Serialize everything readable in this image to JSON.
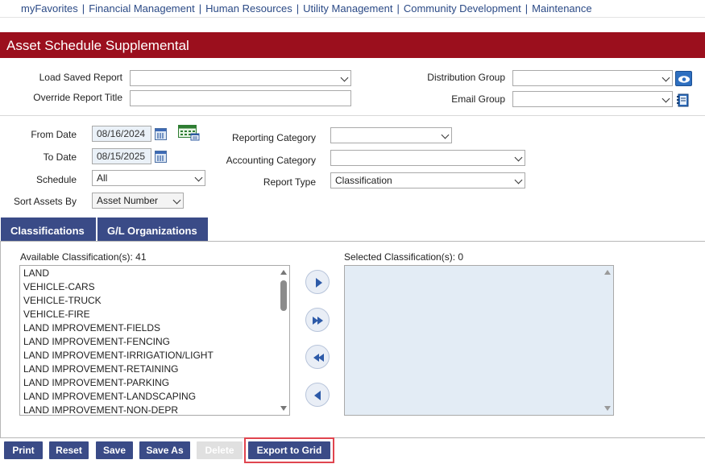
{
  "nav": {
    "items": [
      "myFavorites",
      "Financial Management",
      "Human Resources",
      "Utility Management",
      "Community Development",
      "Maintenance"
    ]
  },
  "page": {
    "title": "Asset Schedule Supplemental"
  },
  "form": {
    "load_saved_report": {
      "label": "Load Saved Report",
      "value": ""
    },
    "override_report_title": {
      "label": "Override Report Title",
      "value": ""
    },
    "distribution_group": {
      "label": "Distribution Group",
      "value": ""
    },
    "email_group": {
      "label": "Email Group",
      "value": ""
    },
    "from_date": {
      "label": "From Date",
      "value": "08/16/2024"
    },
    "to_date": {
      "label": "To Date",
      "value": "08/15/2025"
    },
    "schedule": {
      "label": "Schedule",
      "value": "All"
    },
    "sort_assets_by": {
      "label": "Sort Assets By",
      "value": "Asset Number"
    },
    "reporting_category": {
      "label": "Reporting Category",
      "value": ""
    },
    "accounting_category": {
      "label": "Accounting Category",
      "value": ""
    },
    "report_type": {
      "label": "Report Type",
      "value": "Classification"
    }
  },
  "tabs": [
    {
      "label": "Classifications",
      "active": true
    },
    {
      "label": "G/L Organizations",
      "active": false
    }
  ],
  "classifications": {
    "available_label": "Available Classification(s): 41",
    "selected_label": "Selected Classification(s): 0",
    "available_items": [
      "LAND",
      "VEHICLE-CARS",
      "VEHICLE-TRUCK",
      "VEHICLE-FIRE",
      "LAND IMPROVEMENT-FIELDS",
      "LAND IMPROVEMENT-FENCING",
      "LAND IMPROVEMENT-IRRIGATION/LIGHT",
      "LAND IMPROVEMENT-RETAINING",
      "LAND IMPROVEMENT-PARKING",
      "LAND IMPROVEMENT-LANDSCAPING",
      "LAND IMPROVEMENT-NON-DEPR"
    ],
    "selected_items": []
  },
  "buttons": {
    "print": "Print",
    "reset": "Reset",
    "save": "Save",
    "save_as": "Save As",
    "delete": "Delete",
    "export_to_grid": "Export to Grid"
  },
  "colors": {
    "title_bar": "#9b0f1d",
    "button": "#3a4b87",
    "nav_link": "#2b4a86",
    "highlight": "#e0454f",
    "selected_list_bg": "#e3ecf5"
  },
  "icons": {
    "calendar": "calendar-icon",
    "grid": "grid-calendar-icon",
    "view": "eye-icon",
    "email_book": "address-book-icon",
    "move_right": "arrow-right-icon",
    "move_all_right": "double-arrow-right-icon",
    "move_all_left": "double-arrow-left-icon",
    "move_left": "arrow-left-icon"
  }
}
